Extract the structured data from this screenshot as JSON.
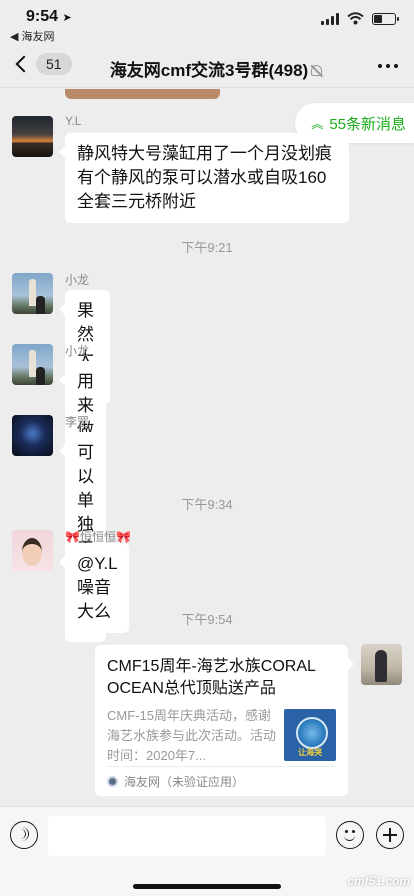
{
  "status_bar": {
    "time": "9:54",
    "back_app": "◀ 海友网",
    "location_glyph": "➤"
  },
  "nav": {
    "back_count": "51",
    "title": "海友网cmf交流3号群(498)"
  },
  "new_messages": {
    "label": "55条新消息",
    "arrow": "︽"
  },
  "messages": [
    {
      "sender": "Y.L",
      "text_lines": [
        "静风特大号藻缸用了一个月没划痕",
        "有个静风的泵可以潜水或自吸160",
        "全套三元桥附近"
      ]
    },
    {
      "sender": "小龙",
      "text": "果然大👍"
    },
    {
      "sender": "小龙",
      "text": "用来做检疫不错"
    },
    {
      "sender": "李罡",
      "text": "可以单独养点海鲜"
    },
    {
      "sender": "🎀恒恒恒🎀",
      "text": "@Y.L 噪音大么"
    }
  ],
  "timestamps": [
    "下午9:21",
    "下午9:34",
    "下午9:54"
  ],
  "link_card": {
    "title": "CMF15周年-海艺水族CORAL OCEAN总代顶贴送产品",
    "description": "CMF-15周年庆典活动，感谢海艺水族参与此次活动。活动时间：2020年7...",
    "thumb_label": "让海哭",
    "source": "海友网（未验证应用）"
  },
  "watermark": "cmf51.com",
  "colors": {
    "background": "#ededed",
    "accent_green": "#1aad19",
    "bubble": "#ffffff",
    "muted_text": "#999999"
  },
  "icons": [
    "signal-bars-icon",
    "wifi-icon",
    "battery-icon",
    "chevron-left-icon",
    "mute-icon",
    "more-icon",
    "voice-icon",
    "emoji-icon",
    "plus-icon"
  ]
}
